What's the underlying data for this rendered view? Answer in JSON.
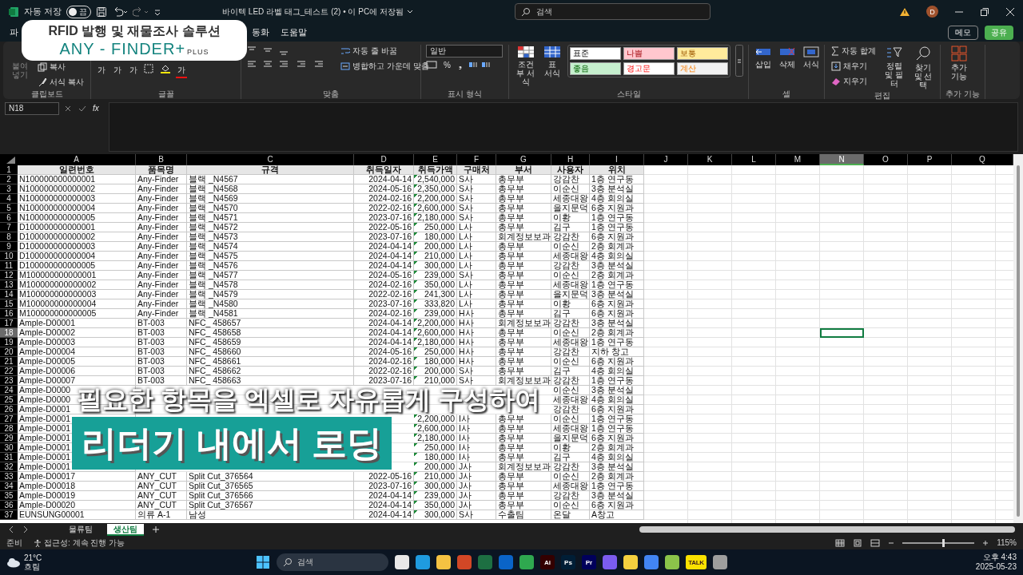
{
  "title_bar": {
    "autosave_label": "자동 저장",
    "autosave": {
      "label": "끔",
      "on": false
    },
    "document_title": "바이텍 LED 라벨 태그_테스트 (2) • 이 PC에 저장됨",
    "search_placeholder": "검색",
    "avatar": "D"
  },
  "promo_card": {
    "subtitle": "RFID 발행 및 재물조사 솔루션",
    "brand": "ANY - FINDER+",
    "brand_suffix": "PLUS"
  },
  "menu_tabs": [
    {
      "label": "파",
      "selected": false
    },
    {
      "label": "동화",
      "selected": false
    },
    {
      "label": "도움말",
      "selected": false
    }
  ],
  "header_buttons": [
    {
      "label": "메모",
      "kind": "outline"
    },
    {
      "label": "공유",
      "kind": "primary"
    }
  ],
  "ribbon": {
    "clipboard": {
      "paste": "붙여넣기",
      "copy": "복사",
      "format_painter": "서식 복사",
      "group": "클립보드"
    },
    "font": {
      "glyphs": [
        "가",
        "가",
        "가"
      ],
      "font_color": "가",
      "group": "글꼴"
    },
    "alignment": {
      "wrap": "자동 줄 바꿈",
      "merge": "병합하고 가운데 맞춤",
      "group": "맞춤"
    },
    "number": {
      "format": "일반",
      "percent": "%",
      "comma": "❟",
      "group": "표시 형식"
    },
    "styles": {
      "conditional": "조건부 서식",
      "table": "표 서식",
      "group": "스타일",
      "cells": [
        {
          "label": "표준",
          "color": "#ffffff"
        },
        {
          "label": "나쁨",
          "color": "#ffc7ce"
        },
        {
          "label": "보통",
          "color": "#ffeb9c"
        },
        {
          "label": "좋음",
          "color": "#c6efce"
        },
        {
          "label": "경고문",
          "color": "#ffffff"
        },
        {
          "label": "계산",
          "color": "#f2f2f2"
        }
      ]
    },
    "cells": {
      "buttons": [
        "삽입",
        "삭제",
        "서식"
      ],
      "group": "셀"
    },
    "editing": {
      "autosum": "자동 합계",
      "fill": "채우기",
      "clear": "지우기",
      "sort": "정렬 및 필터",
      "find": "찾기 및 선택",
      "group": "편집"
    },
    "addins": {
      "button": "추가 기능",
      "group": "추가 기능"
    }
  },
  "formula_bar": {
    "name_box": "N18",
    "fx": "fx"
  },
  "sheet": {
    "columns": [
      {
        "label": "A",
        "selected": false
      },
      {
        "label": "B",
        "selected": false
      },
      {
        "label": "C",
        "selected": false
      },
      {
        "label": "D",
        "selected": false
      },
      {
        "label": "E",
        "selected": false
      },
      {
        "label": "F",
        "selected": false
      },
      {
        "label": "G",
        "selected": false
      },
      {
        "label": "H",
        "selected": false
      },
      {
        "label": "I",
        "selected": false
      },
      {
        "label": "J",
        "selected": false
      },
      {
        "label": "K",
        "selected": false
      },
      {
        "label": "L",
        "selected": false
      },
      {
        "label": "M",
        "selected": false
      },
      {
        "label": "N",
        "selected": true
      },
      {
        "label": "O",
        "selected": false
      },
      {
        "label": "P",
        "selected": false
      },
      {
        "label": "Q",
        "selected": false
      }
    ],
    "rows": [
      {
        "n": "1",
        "kind": "header",
        "selected": false,
        "cells": [
          "일련번호",
          "품목명",
          "규격",
          "취득일자",
          "취득가액",
          "구매처",
          "부서",
          "사용자",
          "위치"
        ]
      },
      {
        "n": "2",
        "kind": "data",
        "selected": false,
        "cells": [
          "N100000000000001",
          "Any-Finder",
          "블랙 _N4567",
          "2024-04-14",
          "2,540,000",
          "S사",
          "총무부",
          "강감찬",
          "1층 연구동"
        ]
      },
      {
        "n": "3",
        "kind": "data",
        "selected": false,
        "cells": [
          "N100000000000002",
          "Any-Finder",
          "블랙 _N4568",
          "2024-05-16",
          "2,350,000",
          "S사",
          "총무부",
          "이순신",
          "3층 분석실"
        ]
      },
      {
        "n": "4",
        "kind": "data",
        "selected": false,
        "cells": [
          "N100000000000003",
          "Any-Finder",
          "블랙 _N4569",
          "2024-02-16",
          "2,200,000",
          "S사",
          "총무부",
          "세종대왕",
          "4층 회의실"
        ]
      },
      {
        "n": "5",
        "kind": "data",
        "selected": false,
        "cells": [
          "N100000000000004",
          "Any-Finder",
          "블랙 _N4570",
          "2022-02-16",
          "2,600,000",
          "S사",
          "총무부",
          "을지문덕",
          "6층 지원과"
        ]
      },
      {
        "n": "6",
        "kind": "data",
        "selected": false,
        "cells": [
          "N100000000000005",
          "Any-Finder",
          "블랙 _N4571",
          "2023-07-16",
          "2,180,000",
          "S사",
          "총무부",
          "이황",
          "1층 연구동"
        ]
      },
      {
        "n": "7",
        "kind": "data",
        "selected": false,
        "cells": [
          "D100000000000001",
          "Any-Finder",
          "블랙 _N4572",
          "2022-05-16",
          "250,000",
          "L사",
          "총무부",
          "김구",
          "1층 연구동"
        ]
      },
      {
        "n": "8",
        "kind": "data",
        "selected": false,
        "cells": [
          "D100000000000002",
          "Any-Finder",
          "블랙 _N4573",
          "2023-07-16",
          "180,000",
          "L사",
          "회계정보보과",
          "강감찬",
          "6층 지원과"
        ]
      },
      {
        "n": "9",
        "kind": "data",
        "selected": false,
        "cells": [
          "D100000000000003",
          "Any-Finder",
          "블랙 _N4574",
          "2024-04-14",
          "200,000",
          "L사",
          "총무부",
          "이순신",
          "2층 회계과"
        ]
      },
      {
        "n": "10",
        "kind": "data",
        "selected": false,
        "cells": [
          "D100000000000004",
          "Any-Finder",
          "블랙 _N4575",
          "2024-04-14",
          "210,000",
          "L사",
          "총무부",
          "세종대왕",
          "4층 회의실"
        ]
      },
      {
        "n": "11",
        "kind": "data",
        "selected": false,
        "cells": [
          "D100000000000005",
          "Any-Finder",
          "블랙 _N4576",
          "2024-04-14",
          "300,000",
          "L사",
          "총무부",
          "강감찬",
          "3층 분석실"
        ]
      },
      {
        "n": "12",
        "kind": "data",
        "selected": false,
        "cells": [
          "M100000000000001",
          "Any-Finder",
          "블랙 _N4577",
          "2024-05-16",
          "239,000",
          "S사",
          "총무부",
          "이순신",
          "2층 회계과"
        ]
      },
      {
        "n": "13",
        "kind": "data",
        "selected": false,
        "cells": [
          "M100000000000002",
          "Any-Finder",
          "블랙 _N4578",
          "2024-02-16",
          "350,000",
          "L사",
          "총무부",
          "세종대왕",
          "1층 연구동"
        ]
      },
      {
        "n": "14",
        "kind": "data",
        "selected": false,
        "cells": [
          "M100000000000003",
          "Any-Finder",
          "블랙 _N4579",
          "2022-02-16",
          "241,300",
          "L사",
          "총무부",
          "을지문덕",
          "3층 분석실"
        ]
      },
      {
        "n": "15",
        "kind": "data",
        "selected": false,
        "cells": [
          "M100000000000004",
          "Any-Finder",
          "블랙 _N4580",
          "2023-07-16",
          "333,820",
          "L사",
          "총무부",
          "이황",
          "6층 지원과"
        ]
      },
      {
        "n": "16",
        "kind": "data",
        "selected": false,
        "cells": [
          "M100000000000005",
          "Any-Finder",
          "블랙 _N4581",
          "2024-02-16",
          "239,000",
          "H사",
          "총무부",
          "김구",
          "6층 지원과"
        ]
      },
      {
        "n": "17",
        "kind": "data",
        "selected": false,
        "cells": [
          "Ample-D00001",
          "BT-003",
          "NFC_ 458657",
          "2024-04-14",
          "2,200,000",
          "H사",
          "회계정보보과",
          "강감찬",
          "3층 분석실"
        ]
      },
      {
        "n": "18",
        "kind": "data",
        "selected": true,
        "cells": [
          "Ample-D00002",
          "BT-003",
          "NFC_ 458658",
          "2024-04-14",
          "2,600,000",
          "H사",
          "총무부",
          "이순신",
          "2층 회계과"
        ]
      },
      {
        "n": "19",
        "kind": "data",
        "selected": false,
        "cells": [
          "Ample-D00003",
          "BT-003",
          "NFC_ 458659",
          "2024-04-14",
          "2,180,000",
          "H사",
          "총무부",
          "세종대왕",
          "1층 연구동"
        ]
      },
      {
        "n": "20",
        "kind": "data",
        "selected": false,
        "cells": [
          "Ample-D00004",
          "BT-003",
          "NFC_ 458660",
          "2024-05-16",
          "250,000",
          "H사",
          "총무부",
          "강감찬",
          "지하 창고"
        ]
      },
      {
        "n": "21",
        "kind": "data",
        "selected": false,
        "cells": [
          "Ample-D00005",
          "BT-003",
          "NFC_ 458661",
          "2024-02-16",
          "180,000",
          "H사",
          "총무부",
          "이순신",
          "6층 지원과"
        ]
      },
      {
        "n": "22",
        "kind": "data",
        "selected": false,
        "cells": [
          "Ample-D00006",
          "BT-003",
          "NFC_ 458662",
          "2022-02-16",
          "200,000",
          "S사",
          "총무부",
          "김구",
          "4층 회의실"
        ]
      },
      {
        "n": "23",
        "kind": "data",
        "selected": false,
        "cells": [
          "Ample-D00007",
          "BT-003",
          "NFC_ 458663",
          "2023-07-16",
          "210,000",
          "S사",
          "회계정보보과",
          "강감찬",
          "1층 연구동"
        ]
      },
      {
        "n": "24",
        "kind": "data",
        "selected": false,
        "cells": [
          "Ample-D0000",
          null,
          null,
          null,
          null,
          null,
          null,
          "이순신",
          "3층 분석실"
        ]
      },
      {
        "n": "25",
        "kind": "data",
        "selected": false,
        "cells": [
          "Ample-D0000",
          null,
          null,
          null,
          null,
          null,
          null,
          "세종대왕",
          "4층 회의실"
        ]
      },
      {
        "n": "26",
        "kind": "data",
        "selected": false,
        "cells": [
          "Ample-D0001",
          null,
          null,
          null,
          null,
          null,
          null,
          "강감찬",
          "6층 지원과"
        ]
      },
      {
        "n": "27",
        "kind": "data",
        "selected": false,
        "cells": [
          "Ample-D0001",
          null,
          null,
          null,
          "2,200,000",
          "I사",
          "총무부",
          "이순신",
          "1층 연구동"
        ]
      },
      {
        "n": "28",
        "kind": "data",
        "selected": false,
        "cells": [
          "Ample-D0001",
          null,
          null,
          null,
          "2,600,000",
          "I사",
          "총무부",
          "세종대왕",
          "1층 연구동"
        ]
      },
      {
        "n": "29",
        "kind": "data",
        "selected": false,
        "cells": [
          "Ample-D0001",
          null,
          null,
          null,
          "2,180,000",
          "I사",
          "총무부",
          "을지문덕",
          "6층 지원과"
        ]
      },
      {
        "n": "30",
        "kind": "data",
        "selected": false,
        "cells": [
          "Ample-D0001",
          null,
          null,
          null,
          "250,000",
          "I사",
          "총무부",
          "이황",
          "2층 회계과"
        ]
      },
      {
        "n": "31",
        "kind": "data",
        "selected": false,
        "cells": [
          "Ample-D0001",
          null,
          null,
          null,
          "180,000",
          "I사",
          "총무부",
          "김구",
          "4층 회의실"
        ]
      },
      {
        "n": "32",
        "kind": "data",
        "selected": false,
        "cells": [
          "Ample-D0001",
          null,
          null,
          null,
          "200,000",
          "J사",
          "회계정보보과",
          "강감찬",
          "3층 분석실"
        ]
      },
      {
        "n": "33",
        "kind": "data",
        "selected": false,
        "cells": [
          "Ample-D00017",
          "ANY_CUT",
          "Split Cut_376564",
          "2022-05-16",
          "210,000",
          "J사",
          "총무부",
          "이순신",
          "2층 회계과"
        ]
      },
      {
        "n": "34",
        "kind": "data",
        "selected": false,
        "cells": [
          "Ample-D00018",
          "ANY_CUT",
          "Split Cut_376565",
          "2023-07-16",
          "300,000",
          "J사",
          "총무부",
          "세종대왕",
          "1층 연구동"
        ]
      },
      {
        "n": "35",
        "kind": "data",
        "selected": false,
        "cells": [
          "Ample-D00019",
          "ANY_CUT",
          "Split Cut_376566",
          "2024-04-14",
          "239,000",
          "J사",
          "총무부",
          "강감찬",
          "3층 분석실"
        ]
      },
      {
        "n": "36",
        "kind": "data",
        "selected": false,
        "cells": [
          "Ample-D00020",
          "ANY_CUT",
          "Split Cut_376567",
          "2024-04-14",
          "350,000",
          "J사",
          "총무부",
          "이순신",
          "6층 지원과"
        ]
      },
      {
        "n": "37",
        "kind": "data",
        "selected": false,
        "cells": [
          "EUNSUNG00001",
          "의류 A-1",
          "남성",
          "2024-04-14",
          "300,000",
          "S사",
          "수출팀",
          "온달",
          "A창고"
        ]
      }
    ]
  },
  "caption": {
    "line1": "필요한 항목을 엑셀로 자유롭게 구성하여",
    "line2": "리더기 내에서 로딩"
  },
  "sheet_tabs": [
    {
      "label": "물류팀",
      "selected": false
    },
    {
      "label": "생산팀",
      "selected": true
    }
  ],
  "status_bar": {
    "ready": "준비",
    "accessibility": "접근성: 계속 진행 가능",
    "zoom": {
      "level": 0.55,
      "reading": "115%"
    }
  },
  "taskbar": {
    "weather": {
      "temp": "21°C",
      "condition": "흐림"
    },
    "search_placeholder": "검색",
    "time": "오후 4:43",
    "date": "2025-05-23",
    "apps": [
      {
        "kind": "shape",
        "color": "#e8e8e8"
      },
      {
        "kind": "shape",
        "color": "#1f9be0"
      },
      {
        "kind": "shape",
        "color": "#f5c242"
      },
      {
        "kind": "shape",
        "color": "#d24726"
      },
      {
        "kind": "shape",
        "color": "#1d6f42"
      },
      {
        "kind": "shape",
        "color": "#0a64c8"
      },
      {
        "kind": "shape",
        "color": "#2fa84f"
      },
      {
        "kind": "tile",
        "label": "Ai",
        "color": "#330000"
      },
      {
        "kind": "tile",
        "label": "Ps",
        "color": "#001e36"
      },
      {
        "kind": "tile",
        "label": "Pr",
        "color": "#00005b"
      },
      {
        "kind": "shape",
        "color": "#7b5cf0"
      },
      {
        "kind": "shape",
        "color": "#f4d03f"
      },
      {
        "kind": "shape",
        "color": "#4285f4"
      },
      {
        "kind": "shape",
        "color": "#8bc34a"
      },
      {
        "kind": "tile",
        "label": "TALK",
        "color": "#fae100"
      },
      {
        "kind": "shape",
        "color": "#9e9e9e"
      }
    ]
  }
}
